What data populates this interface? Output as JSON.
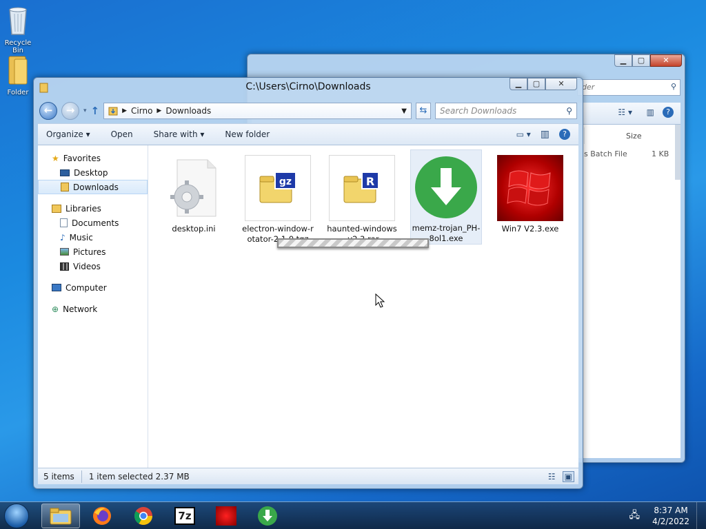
{
  "desktop": {
    "icons": [
      {
        "label": "Recycle Bin"
      },
      {
        "label": "Folder"
      }
    ]
  },
  "back_window": {
    "search_text": "der",
    "column_size": "Size",
    "row_type": "s Batch File",
    "row_size": "1 KB"
  },
  "window": {
    "title": "C:\\Users\\Cirno\\Downloads",
    "breadcrumb": [
      "Cirno",
      "Downloads"
    ],
    "search_placeholder": "Search Downloads",
    "commands": {
      "organize": "Organize ▾",
      "open": "Open",
      "share_with": "Share with ▾",
      "new_folder": "New folder"
    },
    "nav": {
      "favorites": "Favorites",
      "desktop": "Desktop",
      "downloads": "Downloads",
      "libraries": "Libraries",
      "documents": "Documents",
      "music": "Music",
      "pictures": "Pictures",
      "videos": "Videos",
      "computer": "Computer",
      "network": "Network"
    },
    "files": [
      {
        "name": "desktop.ini"
      },
      {
        "name": "electron-window-rotator-2.1.0.tgz"
      },
      {
        "name": "haunted-windows-v2.3.rar"
      },
      {
        "name": "memz-trojan_PH-8ol1.exe"
      },
      {
        "name": "Win7 V2.3.exe"
      }
    ],
    "status": {
      "items": "5 items",
      "selected": "1 item selected  2.37 MB"
    }
  },
  "taskbar": {
    "apps": [
      "explorer",
      "firefox",
      "chrome",
      "7zip",
      "win7-app",
      "memz-app"
    ],
    "time": "8:37 AM",
    "date": "4/2/2022"
  },
  "colors": {
    "accent": "#3c79c6",
    "memz_green": "#3aa84a",
    "win7_red": "#c60d0d"
  }
}
